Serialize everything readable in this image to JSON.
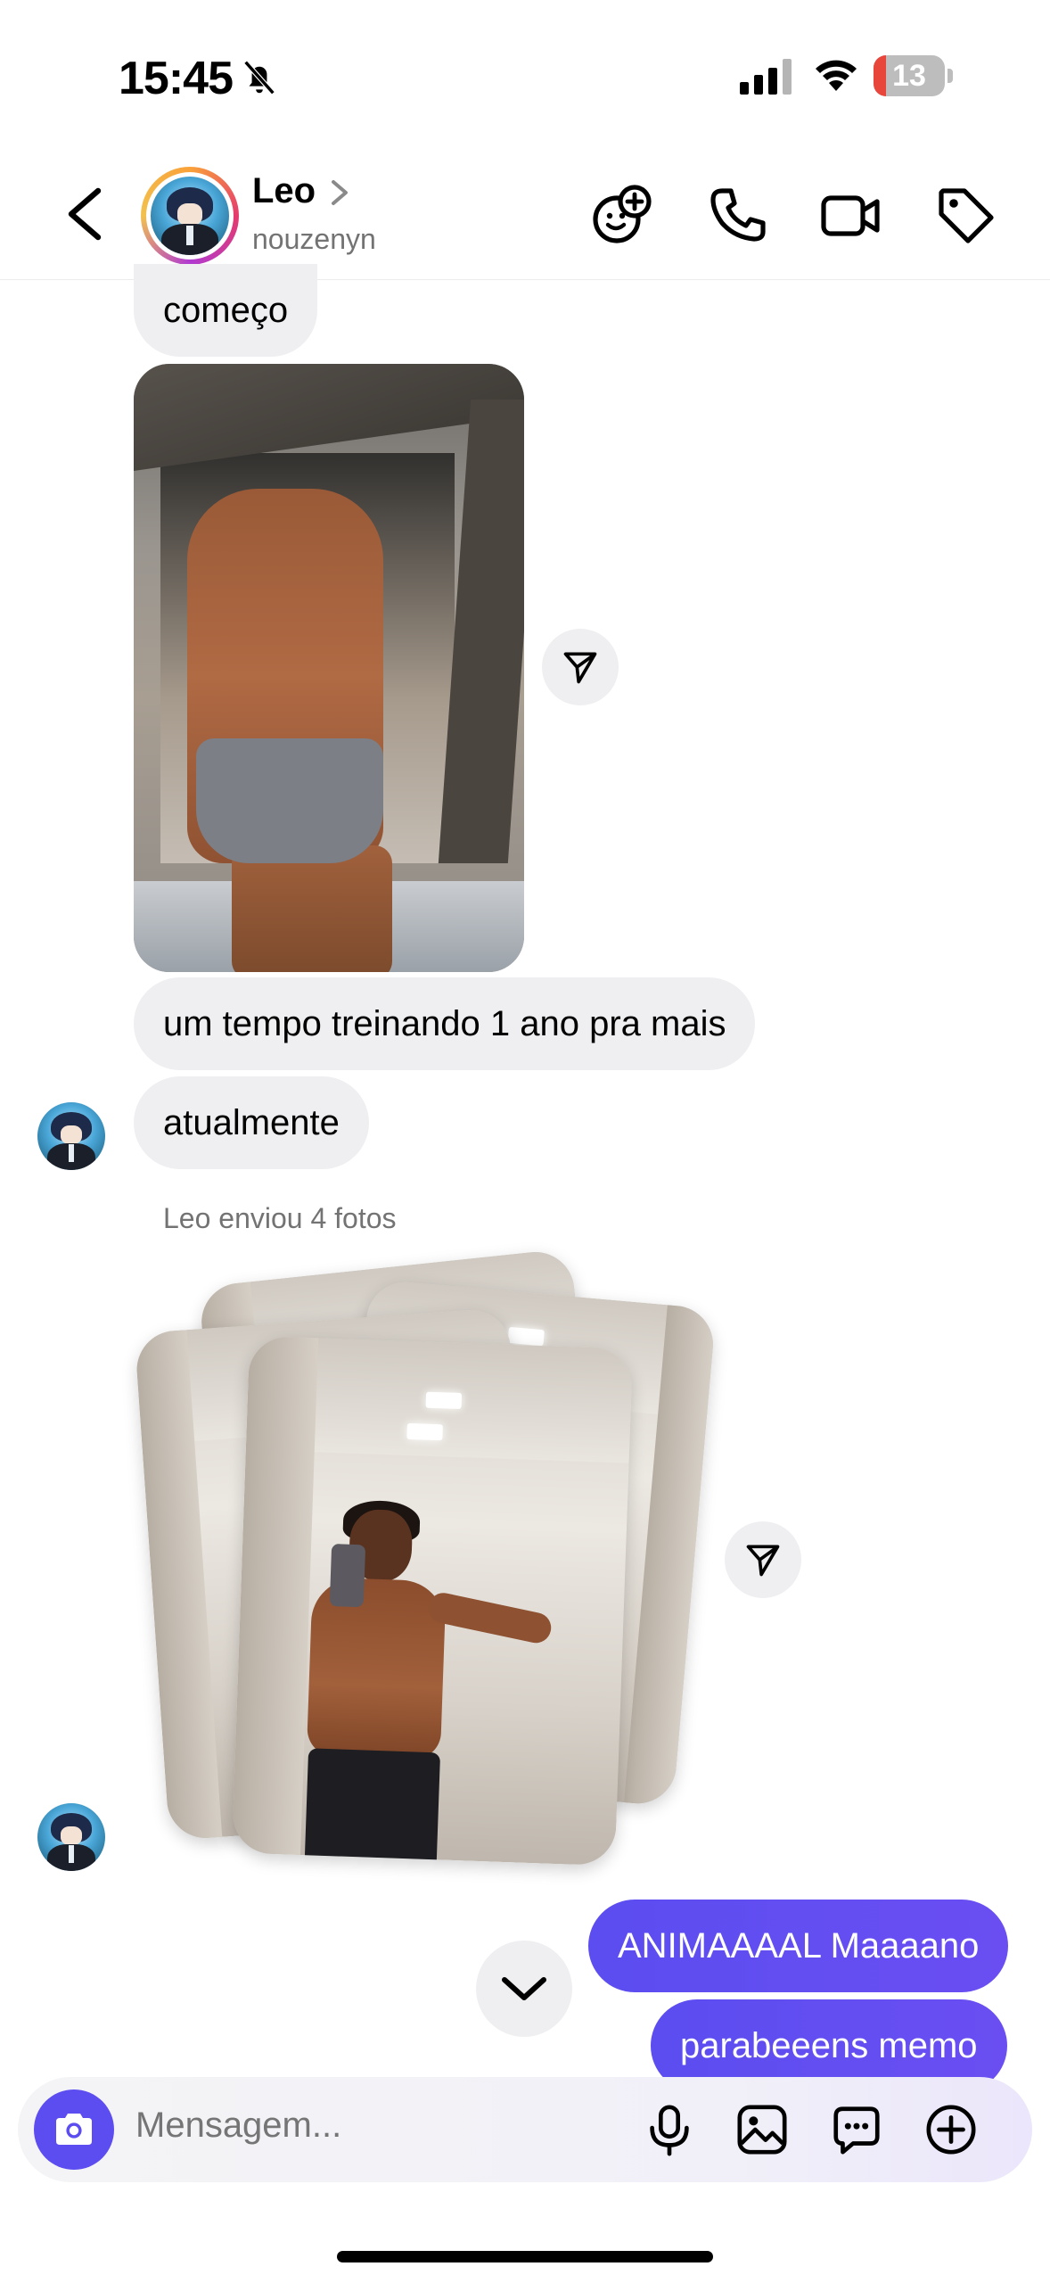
{
  "status_bar": {
    "time": "15:45",
    "battery": "13",
    "icons": [
      "bell-slash-icon",
      "signal-icon",
      "wifi-icon",
      "battery-icon"
    ]
  },
  "header": {
    "name": "Leo",
    "username": "nouzenyn",
    "icons": [
      "back-icon",
      "avatar",
      "chevron-right-icon",
      "add-sticker-icon",
      "phone-icon",
      "video-icon",
      "tag-icon"
    ]
  },
  "messages": {
    "m1": "começo",
    "m2": "um tempo treinando 1 ano pra mais",
    "m3": "atualmente",
    "photos_meta": "Leo enviou 4 fotos",
    "out1": "ANIMAAAAL Maaaano",
    "out2": "parabeeens memo"
  },
  "composer": {
    "placeholder": "Mensagem...",
    "icons": [
      "camera-icon",
      "microphone-icon",
      "gallery-icon",
      "sticker-chat-icon",
      "plus-circle-icon"
    ]
  },
  "colors": {
    "accent": "#5b4df0",
    "incoming_bubble": "#efeff1",
    "secondary_text": "#737373",
    "battery_low": "#e8463a"
  }
}
